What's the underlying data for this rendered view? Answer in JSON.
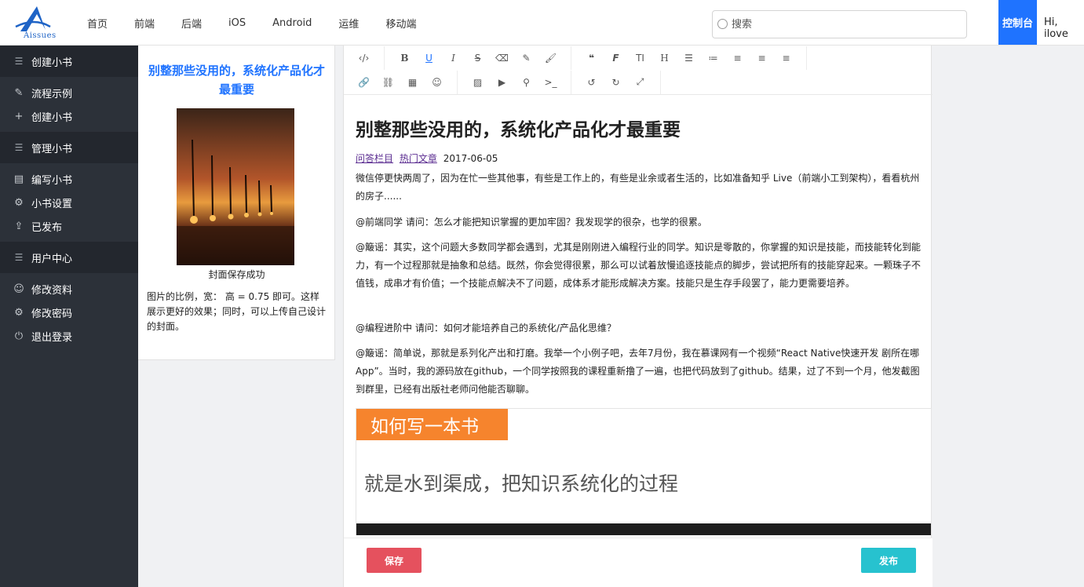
{
  "header": {
    "logo_text": "Aissues",
    "nav": [
      "首页",
      "前端",
      "后端",
      "iOS",
      "Android",
      "运维",
      "移动端"
    ],
    "search_placeholder": "搜索",
    "console_label": "控制台",
    "greeting": "Hi, ilove"
  },
  "sidebar": {
    "sections": [
      {
        "title": "创建小书",
        "items": [
          {
            "label": "流程示例",
            "icon": "edit-icon"
          },
          {
            "label": "创建小书",
            "icon": "plus-icon"
          }
        ]
      },
      {
        "title": "管理小书",
        "items": [
          {
            "label": "编写小书",
            "icon": "book-icon"
          },
          {
            "label": "小书设置",
            "icon": "gear-icon"
          },
          {
            "label": "已发布",
            "icon": "share-icon"
          }
        ]
      },
      {
        "title": "用户中心",
        "items": [
          {
            "label": "修改资料",
            "icon": "user-icon"
          },
          {
            "label": "修改密码",
            "icon": "gear-icon"
          },
          {
            "label": "退出登录",
            "icon": "power-icon"
          }
        ]
      }
    ]
  },
  "cover": {
    "title": "别整那些没用的，系统化产品化才最重要",
    "caption": "封面保存成功",
    "description": "图片的比例，宽： 高 = 0.75 即可。这样展示更好的效果；同时，可以上传自己设计的封面。"
  },
  "editor": {
    "toolbar_row1": [
      "code-icon",
      "bold-icon",
      "underline-icon",
      "italic-icon",
      "strikethrough-icon",
      "eraser-icon",
      "pen-icon",
      "brush-icon",
      "quote-icon",
      "font-icon",
      "text-size-icon",
      "heading-icon",
      "bullet-list-icon",
      "ordered-list-icon",
      "align-left-icon",
      "align-center-icon",
      "align-right-icon"
    ],
    "toolbar_row2": [
      "link-icon",
      "unlink-icon",
      "table-icon",
      "emoji-icon",
      "image-icon",
      "video-icon",
      "location-icon",
      "terminal-icon",
      "undo-icon",
      "redo-icon",
      "fullscreen-icon"
    ],
    "title": "别整那些没用的，系统化产品化才最重要",
    "tags": [
      "问答栏目",
      "热门文章"
    ],
    "date": "2017-06-05",
    "paragraphs": [
      "微信停更快两周了，因为在忙一些其他事，有些是工作上的，有些是业余或者生活的，比如准备知乎 Live（前端小工到架构），看看杭州的房子......",
      "@前端同学 请问：怎么才能把知识掌握的更加牢固？我发现学的很杂，也学的很累。",
      "@簸谣：其实，这个问题大多数同学都会遇到，尤其是刚刚进入编程行业的同学。知识是零散的，你掌握的知识是技能，而技能转化到能力，有一个过程那就是抽象和总结。既然，你会觉得很累，那么可以试着放慢追逐技能点的脚步，尝试把所有的技能穿起来。一颗珠子不值钱，成串才有价值；一个技能点解决不了问题，成体系才能形成解决方案。技能只是生存手段罢了，能力更需要培养。",
      "@编程进阶中 请问：如何才能培养自己的系统化/产品化思维？",
      "@簸谣：简单说，那就是系列化产出和打磨。我举一个小例子吧，去年7月份，我在慕课网有一个视频“React Native快速开发 剧所在哪App”。当时，我的源码放在github，一个同学按照我的课程重新撸了一遍，也把代码放到了github。结果，过了不到一个月，他发截图到群里，已经有出版社老师问他能否聊聊。"
    ],
    "banner_tag": "如何写一本书",
    "banner_sub": "就是水到渠成，把知识系统化的过程",
    "save_label": "保存",
    "publish_label": "发布",
    "colors": {
      "save": "#e5515e",
      "publish": "#27c2cf",
      "accent": "#1f73ff"
    }
  }
}
